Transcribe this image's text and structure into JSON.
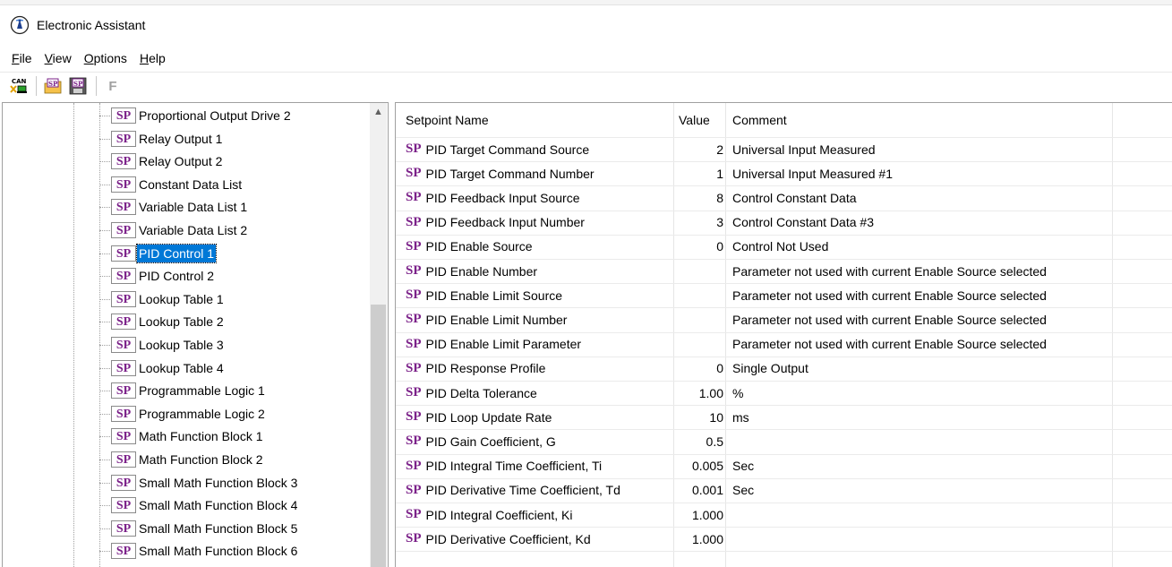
{
  "window": {
    "title": "Electronic Assistant",
    "app_icon": "ea-logo-icon"
  },
  "menu": [
    {
      "label": "File",
      "mnemonic": "F",
      "rest": "ile"
    },
    {
      "label": "View",
      "mnemonic": "V",
      "rest": "iew"
    },
    {
      "label": "Options",
      "mnemonic": "O",
      "rest": "ptions"
    },
    {
      "label": "Help",
      "mnemonic": "H",
      "rest": "elp"
    }
  ],
  "toolbar": {
    "can_icon_text": "CAN",
    "sp_open_text": "SP",
    "sp_save_text": "SP",
    "f_label": "F"
  },
  "tree": {
    "selected_index": 6,
    "items": [
      "Proportional Output Drive 2",
      "Relay Output 1",
      "Relay Output 2",
      "Constant Data List",
      "Variable Data List 1",
      "Variable Data List 2",
      "PID Control 1",
      "PID Control 2",
      "Lookup Table 1",
      "Lookup Table 2",
      "Lookup Table 3",
      "Lookup Table 4",
      "Programmable Logic 1",
      "Programmable Logic 2",
      "Math Function Block 1",
      "Math Function Block 2",
      "Small Math Function Block 3",
      "Small Math Function Block 4",
      "Small Math Function Block 5",
      "Small Math Function Block 6"
    ],
    "icon_text": "SP"
  },
  "table": {
    "headers": {
      "name": "Setpoint Name",
      "value": "Value",
      "comment": "Comment"
    },
    "prefix": "SP",
    "rows": [
      {
        "name": "PID Target Command Source",
        "value": "2",
        "comment": "Universal Input Measured"
      },
      {
        "name": "PID Target Command Number",
        "value": "1",
        "comment": "Universal Input Measured #1"
      },
      {
        "name": "PID Feedback Input Source",
        "value": "8",
        "comment": "Control Constant Data"
      },
      {
        "name": "PID Feedback Input Number",
        "value": "3",
        "comment": "Control Constant Data #3"
      },
      {
        "name": "PID Enable Source",
        "value": "0",
        "comment": "Control Not Used"
      },
      {
        "name": "PID Enable Number",
        "value": "",
        "comment": "Parameter not used with current Enable Source selected"
      },
      {
        "name": "PID Enable Limit Source",
        "value": "",
        "comment": "Parameter not used with current Enable Source selected"
      },
      {
        "name": "PID Enable Limit Number",
        "value": "",
        "comment": "Parameter not used with current Enable Source selected"
      },
      {
        "name": "PID Enable Limit Parameter",
        "value": "",
        "comment": "Parameter not used with current Enable Source selected"
      },
      {
        "name": "PID Response Profile",
        "value": "0",
        "comment": "Single Output"
      },
      {
        "name": "PID Delta Tolerance",
        "value": "1.00",
        "comment": "%"
      },
      {
        "name": "PID Loop Update Rate",
        "value": "10",
        "comment": "ms"
      },
      {
        "name": "PID Gain Coefficient, G",
        "value": "0.5",
        "comment": ""
      },
      {
        "name": "PID Integral Time Coefficient, Ti",
        "value": "0.005",
        "comment": "Sec"
      },
      {
        "name": "PID Derivative Time Coefficient, Td",
        "value": "0.001",
        "comment": "Sec"
      },
      {
        "name": "PID Integral Coefficient, Ki",
        "value": "1.000",
        "comment": ""
      },
      {
        "name": "PID Derivative Coefficient, Kd",
        "value": "1.000",
        "comment": ""
      }
    ]
  },
  "colors": {
    "sp_purple": "#7b2189",
    "selection": "#0078d7"
  }
}
